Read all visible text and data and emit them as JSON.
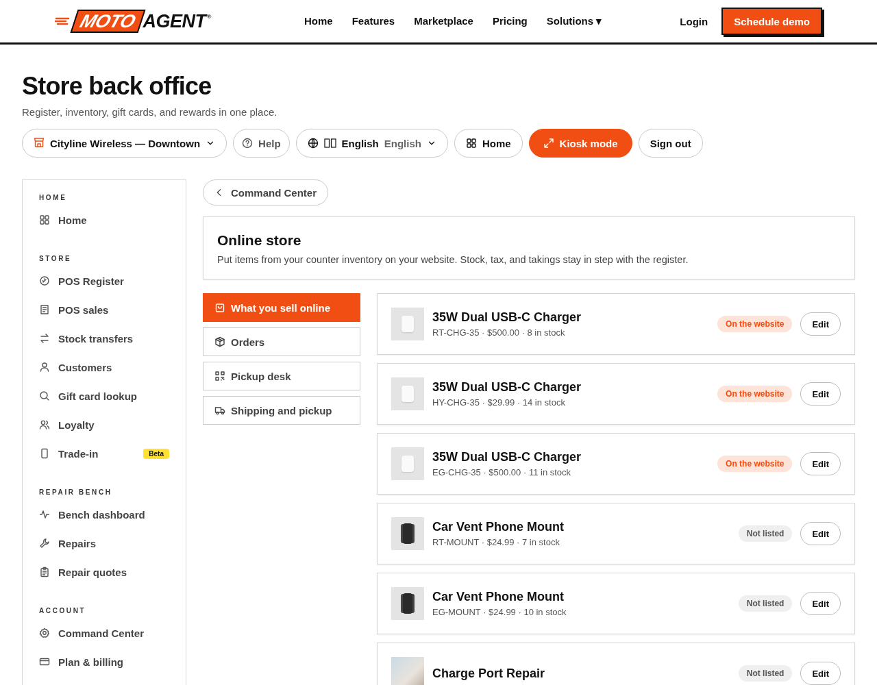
{
  "header": {
    "logo": {
      "left": "MOTO",
      "right": "AGENT",
      "mark": "®"
    },
    "nav": [
      {
        "label": "Home"
      },
      {
        "label": "Features"
      },
      {
        "label": "Marketplace"
      },
      {
        "label": "Pricing"
      },
      {
        "label": "Solutions ▾"
      }
    ],
    "login": "Login",
    "cta": "Schedule demo"
  },
  "page": {
    "title": "Store back office",
    "subtitle": "Register, inventory, gift cards, and rewards in one place."
  },
  "toolbar": {
    "location": "Cityline Wireless — Downtown",
    "help": "Help",
    "language": {
      "label": "English",
      "native": "English"
    },
    "home": "Home",
    "kiosk": "Kiosk mode",
    "sign_out": "Sign out"
  },
  "sidebar": {
    "sections": [
      {
        "heading": "HOME",
        "items": [
          {
            "label": "Home"
          }
        ]
      },
      {
        "heading": "STORE",
        "items": [
          {
            "label": "POS Register"
          },
          {
            "label": "POS sales"
          },
          {
            "label": "Stock transfers"
          },
          {
            "label": "Customers"
          },
          {
            "label": "Gift card lookup"
          },
          {
            "label": "Loyalty"
          },
          {
            "label": "Trade-in",
            "badge": "Beta"
          }
        ]
      },
      {
        "heading": "REPAIR BENCH",
        "items": [
          {
            "label": "Bench dashboard"
          },
          {
            "label": "Repairs"
          },
          {
            "label": "Repair quotes"
          }
        ]
      },
      {
        "heading": "ACCOUNT",
        "items": [
          {
            "label": "Command Center"
          },
          {
            "label": "Plan & billing"
          }
        ]
      }
    ]
  },
  "back_button": "Command Center",
  "store": {
    "title": "Online store",
    "description": "Put items from your counter inventory on your website. Stock, tax, and takings stay in step with the register.",
    "tabs": [
      {
        "label": "What you sell online",
        "selected": true
      },
      {
        "label": "Orders",
        "selected": false
      },
      {
        "label": "Pickup desk",
        "selected": false
      },
      {
        "label": "Shipping and pickup",
        "selected": false
      }
    ],
    "products": [
      {
        "kind": "charger",
        "name": "35W Dual USB-C Charger",
        "details": "RT-CHG-35 · $500.00 · 8 in stock",
        "listed": true,
        "status": "On the website",
        "action": "Edit"
      },
      {
        "kind": "charger",
        "name": "35W Dual USB-C Charger",
        "details": "HY-CHG-35 · $29.99 · 14 in stock",
        "listed": true,
        "status": "On the website",
        "action": "Edit"
      },
      {
        "kind": "charger",
        "name": "35W Dual USB-C Charger",
        "details": "EG-CHG-35 · $500.00 · 11 in stock",
        "listed": true,
        "status": "On the website",
        "action": "Edit"
      },
      {
        "kind": "mount",
        "name": "Car Vent Phone Mount",
        "details": "RT-MOUNT · $24.99 · 7 in stock",
        "listed": false,
        "status": "Not listed",
        "action": "Edit"
      },
      {
        "kind": "mount",
        "name": "Car Vent Phone Mount",
        "details": "EG-MOUNT · $24.99 · 10 in stock",
        "listed": false,
        "status": "Not listed",
        "action": "Edit"
      },
      {
        "kind": "photo",
        "name": "Charge Port Repair",
        "listed": false,
        "status": "Not listed",
        "action": "Edit"
      }
    ]
  }
}
